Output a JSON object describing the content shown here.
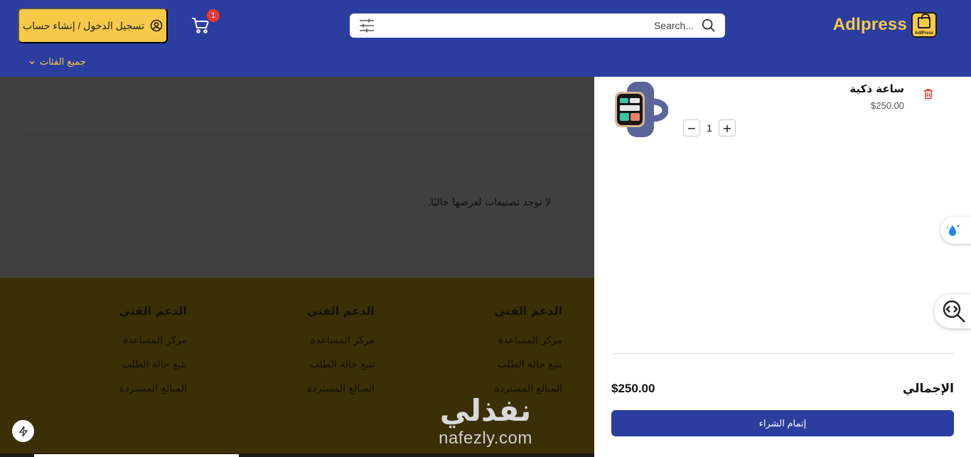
{
  "header": {
    "logo_text": "Adlpress",
    "logo_sub": "AdlPress",
    "search_placeholder": "Search...",
    "cart_count": "1",
    "login_label": "تسجيل الدخول / إنشاء حساب",
    "categories_label": "جميع الفئات"
  },
  "main": {
    "empty_message": "لا توجد تصنيفات لعرضها حاليًا."
  },
  "footer": {
    "columns": [
      {
        "title": "الدعم الفني",
        "links": [
          "مركز المساعدة",
          "تتبع حالة الطلب",
          "المبالغ المستردة"
        ]
      },
      {
        "title": "الدعم الفني",
        "links": [
          "مركز المساعدة",
          "تتبع حالة الطلب",
          "المبالغ المستردة"
        ]
      },
      {
        "title": "الدعم الفني",
        "links": [
          "مركز المساعدة",
          "تتبع حالة الطلب",
          "المبالغ المستردة"
        ]
      }
    ]
  },
  "watermark": {
    "arabic": "نفذلي",
    "latin": "nafezly.com"
  },
  "cart_drawer": {
    "item": {
      "name": "ساعة ذكية",
      "price": "$250.00",
      "quantity": "1"
    },
    "total_label": "الإجمالي",
    "total_value": "$250.00",
    "checkout_label": "إتمام الشراء"
  },
  "colors": {
    "brand_blue": "#2b3ea0",
    "accent_yellow": "#f7c948",
    "badge_red": "#e53935"
  },
  "icons": [
    "search-icon",
    "filter-icon",
    "cart-icon",
    "user-circle-icon",
    "chevron-down-icon",
    "trash-icon",
    "minus-icon",
    "plus-icon",
    "water-drop-icon",
    "code-search-icon",
    "bolt-icon"
  ]
}
